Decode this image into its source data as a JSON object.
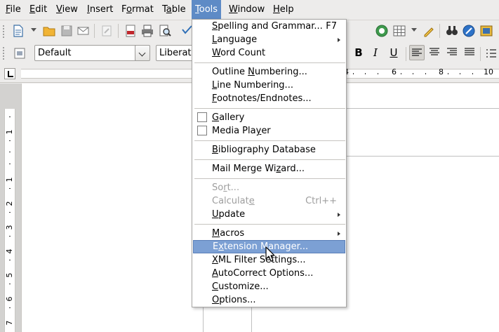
{
  "menubar": {
    "items": [
      {
        "pre": "",
        "u": "F",
        "post": "ile"
      },
      {
        "pre": "",
        "u": "E",
        "post": "dit"
      },
      {
        "pre": "",
        "u": "V",
        "post": "iew"
      },
      {
        "pre": "",
        "u": "I",
        "post": "nsert"
      },
      {
        "pre": "F",
        "u": "o",
        "post": "rmat"
      },
      {
        "pre": "T",
        "u": "a",
        "post": "ble"
      },
      {
        "pre": "",
        "u": "T",
        "post": "ools"
      },
      {
        "pre": "",
        "u": "W",
        "post": "indow"
      },
      {
        "pre": "",
        "u": "H",
        "post": "elp"
      }
    ]
  },
  "format_bar": {
    "style_value": "Default",
    "font_value": "Liberat",
    "bold": "B",
    "italic": "I",
    "underline": "U"
  },
  "ruler": {
    "h_numbers": [
      "4",
      "6",
      "8",
      "10"
    ],
    "v_numbers": [
      "1",
      "1",
      "2",
      "3",
      "4",
      "5",
      "6",
      "7"
    ]
  },
  "tools_menu": {
    "items": [
      {
        "pre": "",
        "u": "S",
        "post": "pelling and Grammar...",
        "shortcut": "F7"
      },
      {
        "pre": "",
        "u": "L",
        "post": "anguage",
        "submenu": true
      },
      {
        "pre": "",
        "u": "W",
        "post": "ord Count"
      },
      {
        "pre": "Outline ",
        "u": "N",
        "post": "umbering..."
      },
      {
        "pre": "",
        "u": "L",
        "post": "ine Numbering..."
      },
      {
        "pre": "",
        "u": "F",
        "post": "ootnotes/Endnotes..."
      },
      {
        "pre": "",
        "u": "G",
        "post": "allery",
        "checkbox": true
      },
      {
        "pre": "Media Pla",
        "u": "y",
        "post": "er",
        "checkbox": true
      },
      {
        "pre": "",
        "u": "B",
        "post": "ibliography Database"
      },
      {
        "pre": "Mail Merge Wi",
        "u": "z",
        "post": "ard..."
      },
      {
        "pre": "So",
        "u": "r",
        "post": "t...",
        "disabled": true
      },
      {
        "pre": "Calculat",
        "u": "e",
        "post": "",
        "shortcut": "Ctrl++",
        "disabled": true
      },
      {
        "pre": "",
        "u": "U",
        "post": "pdate",
        "submenu": true
      },
      {
        "pre": "",
        "u": "M",
        "post": "acros",
        "submenu": true
      },
      {
        "pre": "E",
        "u": "x",
        "post": "tension Manager...",
        "highlighted": true
      },
      {
        "pre": "",
        "u": "X",
        "post": "ML Filter Settings..."
      },
      {
        "pre": "",
        "u": "A",
        "post": "utoCorrect Options..."
      },
      {
        "pre": "",
        "u": "C",
        "post": "ustomize..."
      },
      {
        "pre": "",
        "u": "O",
        "post": "ptions..."
      }
    ]
  },
  "icons": {
    "standard_toolbar": [
      "new-document-icon",
      "open-folder-icon",
      "save-icon",
      "email-icon",
      "edit-file-icon",
      "export-pdf-icon",
      "print-icon",
      "print-preview-icon",
      "spellcheck-icon",
      "navigator-icon",
      "table-icon",
      "draw-functions-icon",
      "find-replace-icon",
      "gallery-icon",
      "insert-image-icon"
    ]
  }
}
